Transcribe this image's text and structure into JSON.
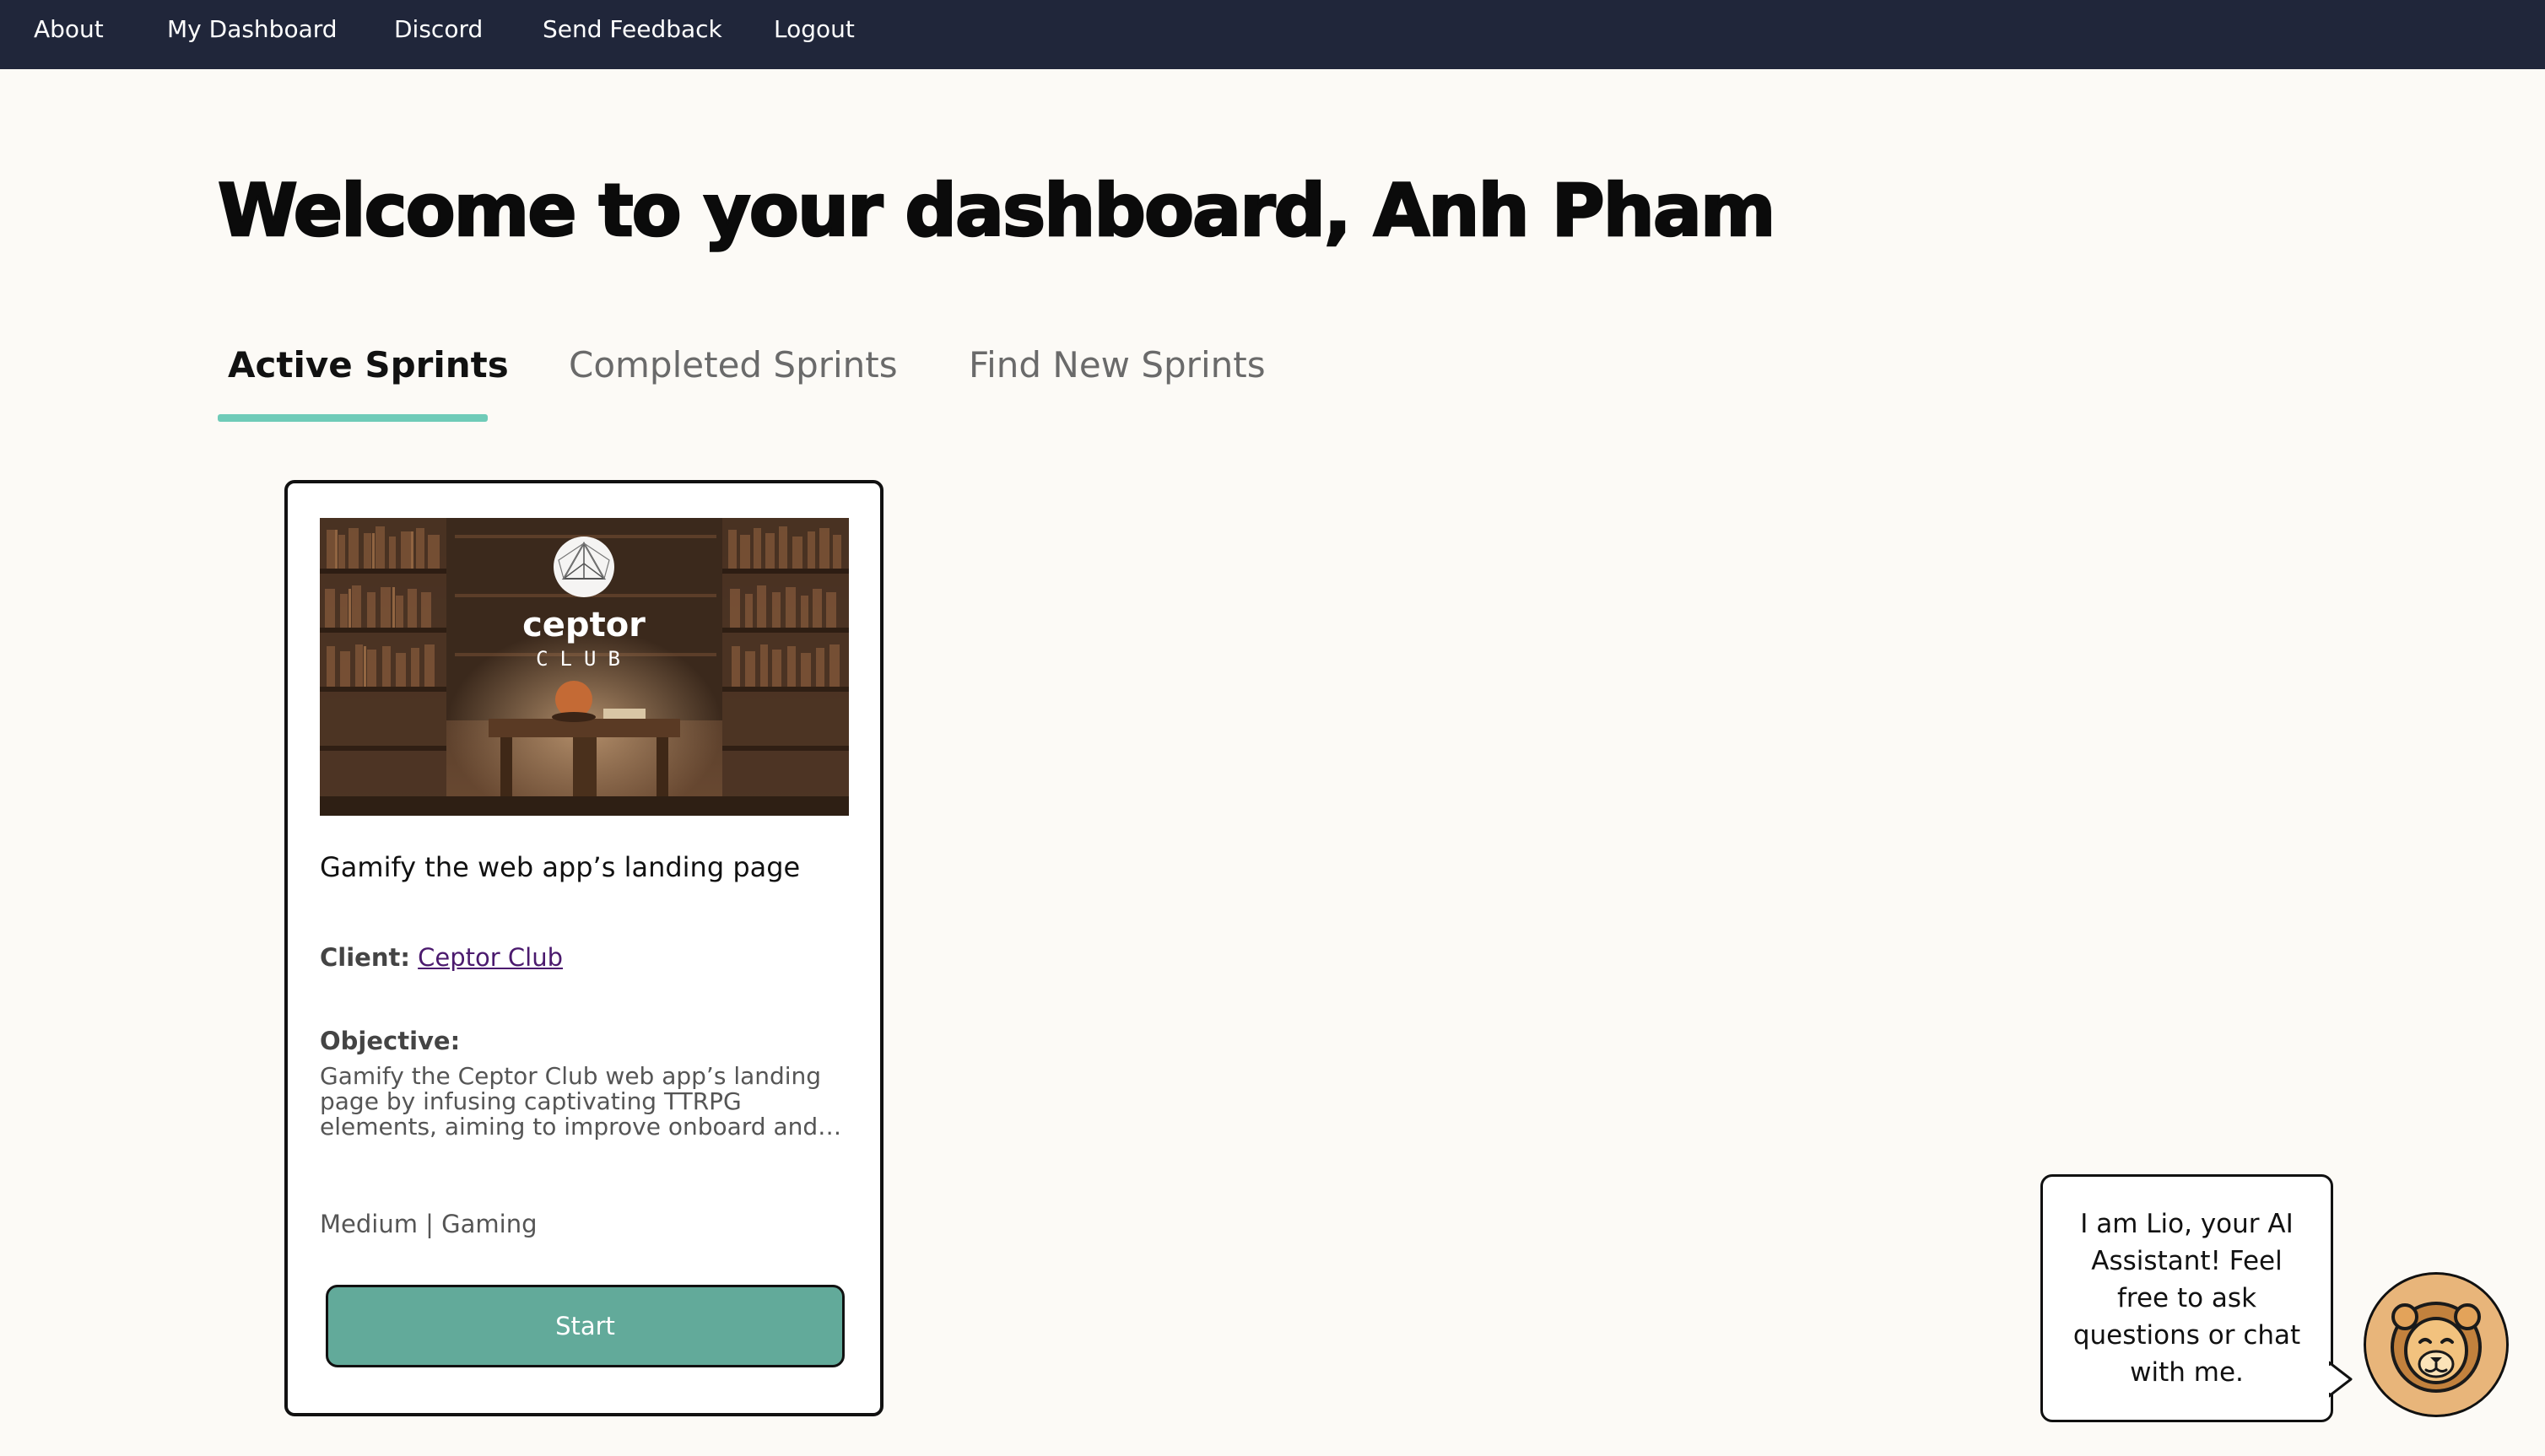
{
  "nav": {
    "items": [
      {
        "label": "About"
      },
      {
        "label": "My Dashboard"
      },
      {
        "label": "Discord"
      },
      {
        "label": "Send Feedback"
      },
      {
        "label": "Logout"
      }
    ]
  },
  "page": {
    "title": "Welcome to your dashboard, Anh Pham"
  },
  "tabs": [
    {
      "label": "Active Sprints",
      "active": true
    },
    {
      "label": "Completed Sprints",
      "active": false
    },
    {
      "label": "Find New Sprints",
      "active": false
    }
  ],
  "sprint_card": {
    "image_logo_text": "ceptor",
    "image_logo_subtext": "CLUB",
    "title": "Gamify the web app’s landing page",
    "client_label": "Client:",
    "client_name": "Ceptor Club",
    "objective_label": "Objective:",
    "objective_text": "Gamify the Ceptor Club web app’s landing page by infusing captivating TTRPG elements, aiming to improve onboard and enhance user…",
    "meta": "Medium | Gaming",
    "start_label": "Start"
  },
  "assistant": {
    "message": "I am Lio, your AI Assistant! Feel free to ask questions or chat with me.",
    "avatar_icon": "lion-face-icon"
  },
  "colors": {
    "nav_bg": "#20263a",
    "page_bg": "#fcfaf6",
    "tab_accent": "#6fcbb8",
    "start_button": "#62aa9a",
    "client_link": "#4b1a6e",
    "avatar_bg": "#e8b57a"
  }
}
